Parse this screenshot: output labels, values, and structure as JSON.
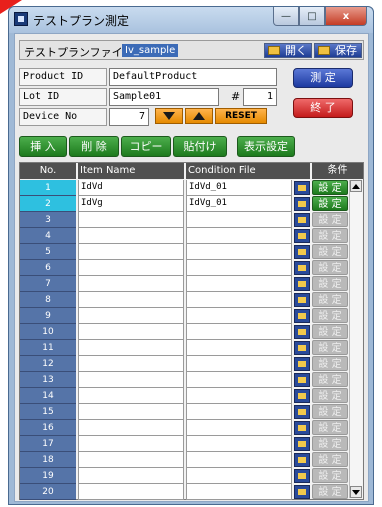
{
  "window": {
    "title": "テストプラン測定",
    "minimize_label": "—",
    "maximize_label": "□",
    "close_label": "x"
  },
  "file": {
    "label": "テストプランファイル",
    "value": "Iv_sample",
    "open_label": "開く",
    "save_label": "保存"
  },
  "params": {
    "product_id_label": "Product ID",
    "product_id_value": "DefaultProduct",
    "lot_id_label": "Lot ID",
    "lot_id_value": "Sample01",
    "hash_label": "#",
    "hash_value": "1",
    "device_no_label": "Device No",
    "device_no_value": "7",
    "reset_label": "RESET"
  },
  "actions": {
    "measure_label": "測 定",
    "end_label": "終 了",
    "insert_label": "挿 入",
    "delete_label": "削 除",
    "copy_label": "コピー",
    "paste_label": "貼付け",
    "display_settings_label": "表示設定"
  },
  "grid": {
    "headers": [
      "No.",
      "Item Name",
      "Condition File",
      "条件"
    ],
    "set_label": "設 定",
    "rows": [
      {
        "no": "1",
        "item": "IdVd",
        "cond": "IdVd_01",
        "active": true,
        "selected": true
      },
      {
        "no": "2",
        "item": "IdVg",
        "cond": "IdVg_01",
        "active": true,
        "selected": true
      },
      {
        "no": "3",
        "item": "",
        "cond": "",
        "active": false,
        "selected": false
      },
      {
        "no": "4",
        "item": "",
        "cond": "",
        "active": false,
        "selected": false
      },
      {
        "no": "5",
        "item": "",
        "cond": "",
        "active": false,
        "selected": false
      },
      {
        "no": "6",
        "item": "",
        "cond": "",
        "active": false,
        "selected": false
      },
      {
        "no": "7",
        "item": "",
        "cond": "",
        "active": false,
        "selected": false
      },
      {
        "no": "8",
        "item": "",
        "cond": "",
        "active": false,
        "selected": false
      },
      {
        "no": "9",
        "item": "",
        "cond": "",
        "active": false,
        "selected": false
      },
      {
        "no": "10",
        "item": "",
        "cond": "",
        "active": false,
        "selected": false
      },
      {
        "no": "11",
        "item": "",
        "cond": "",
        "active": false,
        "selected": false
      },
      {
        "no": "12",
        "item": "",
        "cond": "",
        "active": false,
        "selected": false
      },
      {
        "no": "13",
        "item": "",
        "cond": "",
        "active": false,
        "selected": false
      },
      {
        "no": "14",
        "item": "",
        "cond": "",
        "active": false,
        "selected": false
      },
      {
        "no": "15",
        "item": "",
        "cond": "",
        "active": false,
        "selected": false
      },
      {
        "no": "16",
        "item": "",
        "cond": "",
        "active": false,
        "selected": false
      },
      {
        "no": "17",
        "item": "",
        "cond": "",
        "active": false,
        "selected": false
      },
      {
        "no": "18",
        "item": "",
        "cond": "",
        "active": false,
        "selected": false
      },
      {
        "no": "19",
        "item": "",
        "cond": "",
        "active": false,
        "selected": false
      },
      {
        "no": "20",
        "item": "",
        "cond": "",
        "active": false,
        "selected": false
      }
    ]
  },
  "colors": {
    "accent_blue": "#1d3aa0",
    "accent_red": "#c41b1b",
    "accent_green": "#1d7a1d",
    "accent_orange": "#e58a00",
    "row_selected": "#2ec0e0",
    "row_number": "#5574a8"
  }
}
